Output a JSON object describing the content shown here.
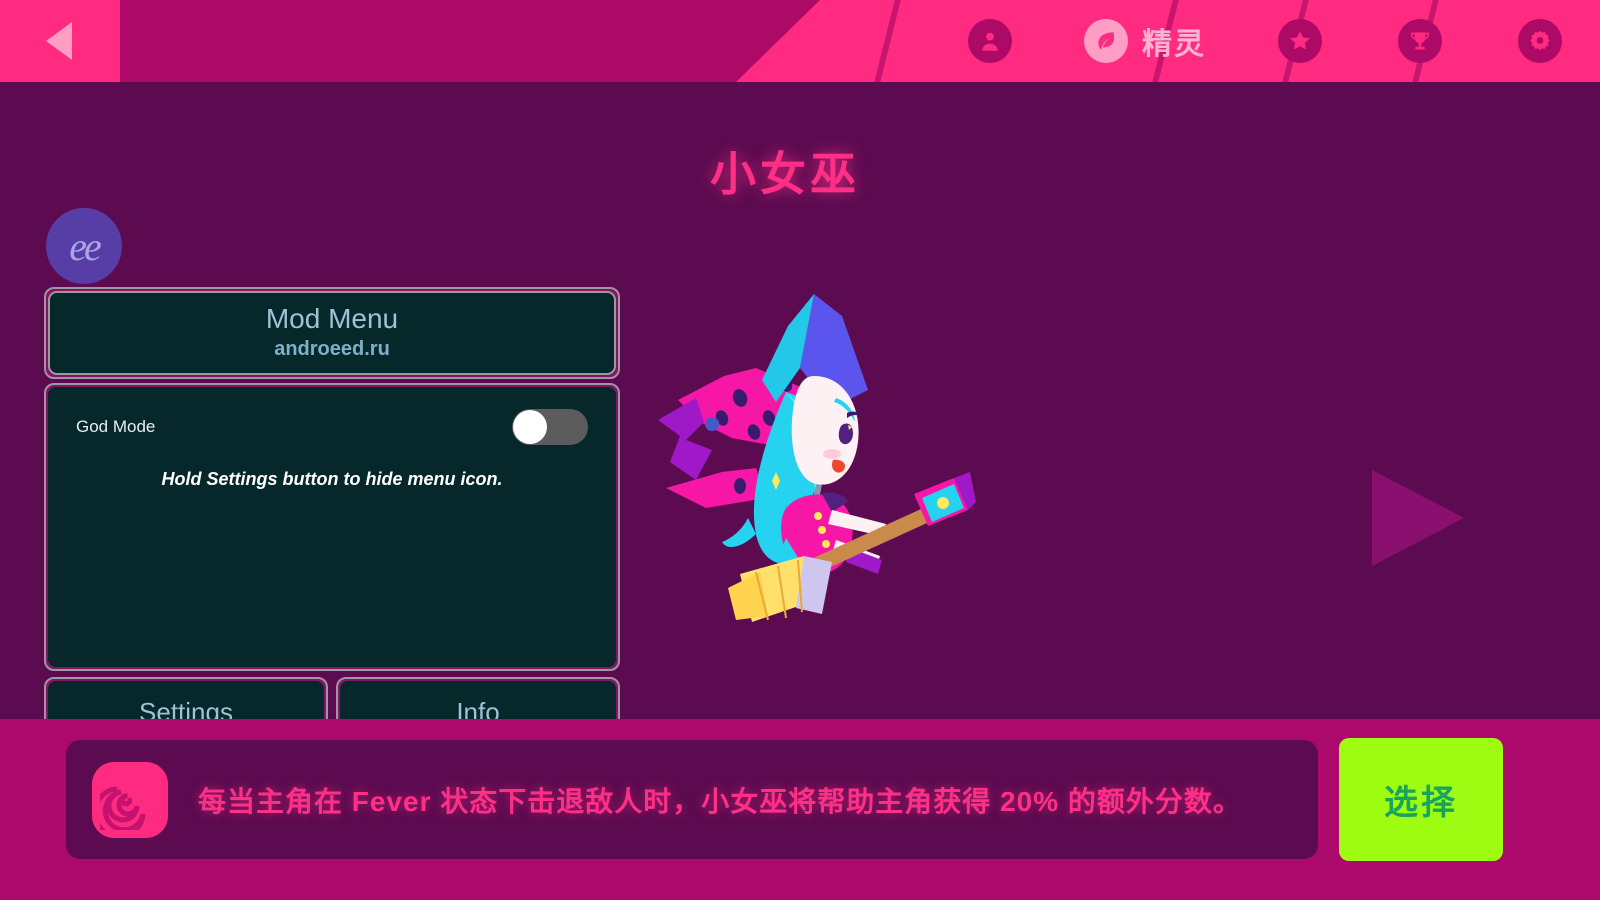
{
  "topbar": {
    "back_icon": "back-arrow-icon",
    "tabs": [
      {
        "id": "profile",
        "icon": "person-icon",
        "label": "",
        "active": false
      },
      {
        "id": "spirit",
        "icon": "leaf-icon",
        "label": "精灵",
        "active": true
      },
      {
        "id": "star",
        "icon": "star-icon",
        "label": "",
        "active": false
      },
      {
        "id": "trophy",
        "icon": "trophy-icon",
        "label": "",
        "active": false
      },
      {
        "id": "settings",
        "icon": "gear-icon",
        "label": "",
        "active": false
      }
    ]
  },
  "stage": {
    "character_title": "小女巫",
    "next_icon": "next-arrow-icon",
    "character_art": "witch-on-broom-illustration"
  },
  "mod_launcher": {
    "logo_text": "ee",
    "icon": "mod-menu-launcher-icon"
  },
  "mod_menu": {
    "title": "Mod Menu",
    "subtitle": "androeed.ru",
    "rows": [
      {
        "label": "God Mode",
        "type": "toggle",
        "value": "off"
      }
    ],
    "hint": "Hold Settings button to hide menu icon.",
    "buttons": [
      {
        "id": "settings",
        "label": "Settings"
      },
      {
        "id": "info",
        "label": "Info"
      }
    ]
  },
  "bottom": {
    "banner_icon": "spiral-icon",
    "banner_text": "每当主角在 Fever 状态下击退敌人时，小女巫将帮助主角获得 20% 的额外分数。",
    "select_label": "选择"
  },
  "colors": {
    "header_pink": "#ff2b80",
    "header_dark": "#ad0a68",
    "stage_purple": "#5c0b50",
    "bottom_magenta": "#ab0a6c",
    "title_pink": "#ff2f86",
    "panel_teal": "#07282b",
    "panel_border": "#9a9a9a",
    "panel_frame": "#8a1070",
    "select_green": "#9dfc12",
    "select_text": "#1aa35e"
  }
}
